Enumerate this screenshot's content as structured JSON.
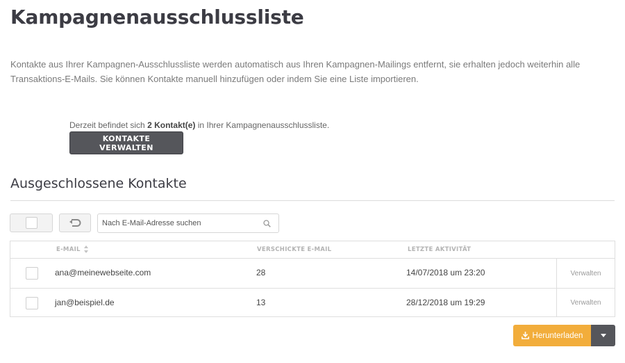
{
  "page": {
    "title": "Kampagnenausschlussliste",
    "intro": "Kontakte aus Ihrer Kampagnen-Ausschlussliste werden automatisch aus Ihren Kampagnen-Mailings entfernt, sie erhalten jedoch weiterhin alle Transaktions-E-Mails. Sie können Kontakte manuell hinzufügen oder indem Sie eine Liste importieren."
  },
  "summary": {
    "prefix": "Derzeit befindet sich ",
    "count": "2 Kontakt(e)",
    "suffix": " in Ihrer Kampagnenausschlussliste.",
    "manage_button": "KONTAKTE VERWALTEN"
  },
  "excluded": {
    "title": "Ausgeschlossene Kontakte",
    "search_placeholder": "Nach E-Mail-Adresse suchen",
    "columns": {
      "email": "E-MAIL",
      "sent": "VERSCHICKTE E-MAIL",
      "last_activity": "LETZTE AKTIVITÄT"
    },
    "rows": [
      {
        "email": "ana@meinewebseite.com",
        "sent": "28",
        "last_activity": "14/07/2018 um 23:20",
        "action": "Verwalten"
      },
      {
        "email": "jan@beispiel.de",
        "sent": "13",
        "last_activity": "28/12/2018 um 19:29",
        "action": "Verwalten"
      }
    ],
    "download_label": "Herunterladen"
  },
  "icons": {
    "search": "search-icon",
    "undo": "undo-icon",
    "sort": "sort-icon",
    "download": "download-icon",
    "dropdown": "caret-down-icon"
  },
  "colors": {
    "primary_dark": "#55565b",
    "accent": "#f2ad3b",
    "heading": "#3c3c44"
  }
}
